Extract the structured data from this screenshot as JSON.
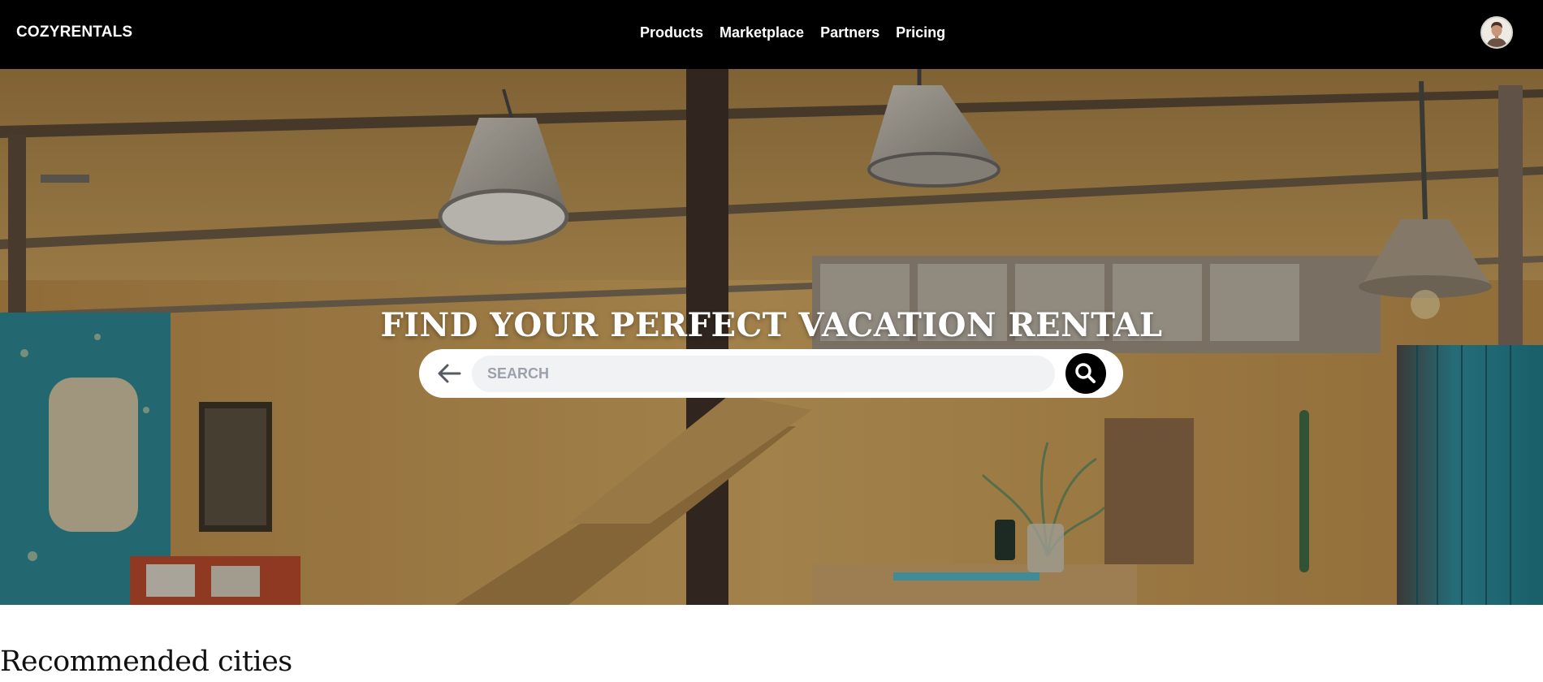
{
  "header": {
    "brand": "COZYRENTALS",
    "nav": [
      "Products",
      "Marketplace",
      "Partners",
      "Pricing"
    ],
    "avatar_icon": "user-avatar"
  },
  "hero": {
    "title": "FIND YOUR PERFECT VACATION RENTAL",
    "search": {
      "placeholder": "SEARCH",
      "value": "",
      "back_icon": "arrow-left-icon",
      "submit_icon": "search-icon"
    }
  },
  "sections": {
    "recommended_title": "Recommended cities"
  },
  "colors": {
    "navbar_bg": "#000000",
    "search_button_bg": "#000000",
    "search_field_bg": "#f1f2f4"
  }
}
